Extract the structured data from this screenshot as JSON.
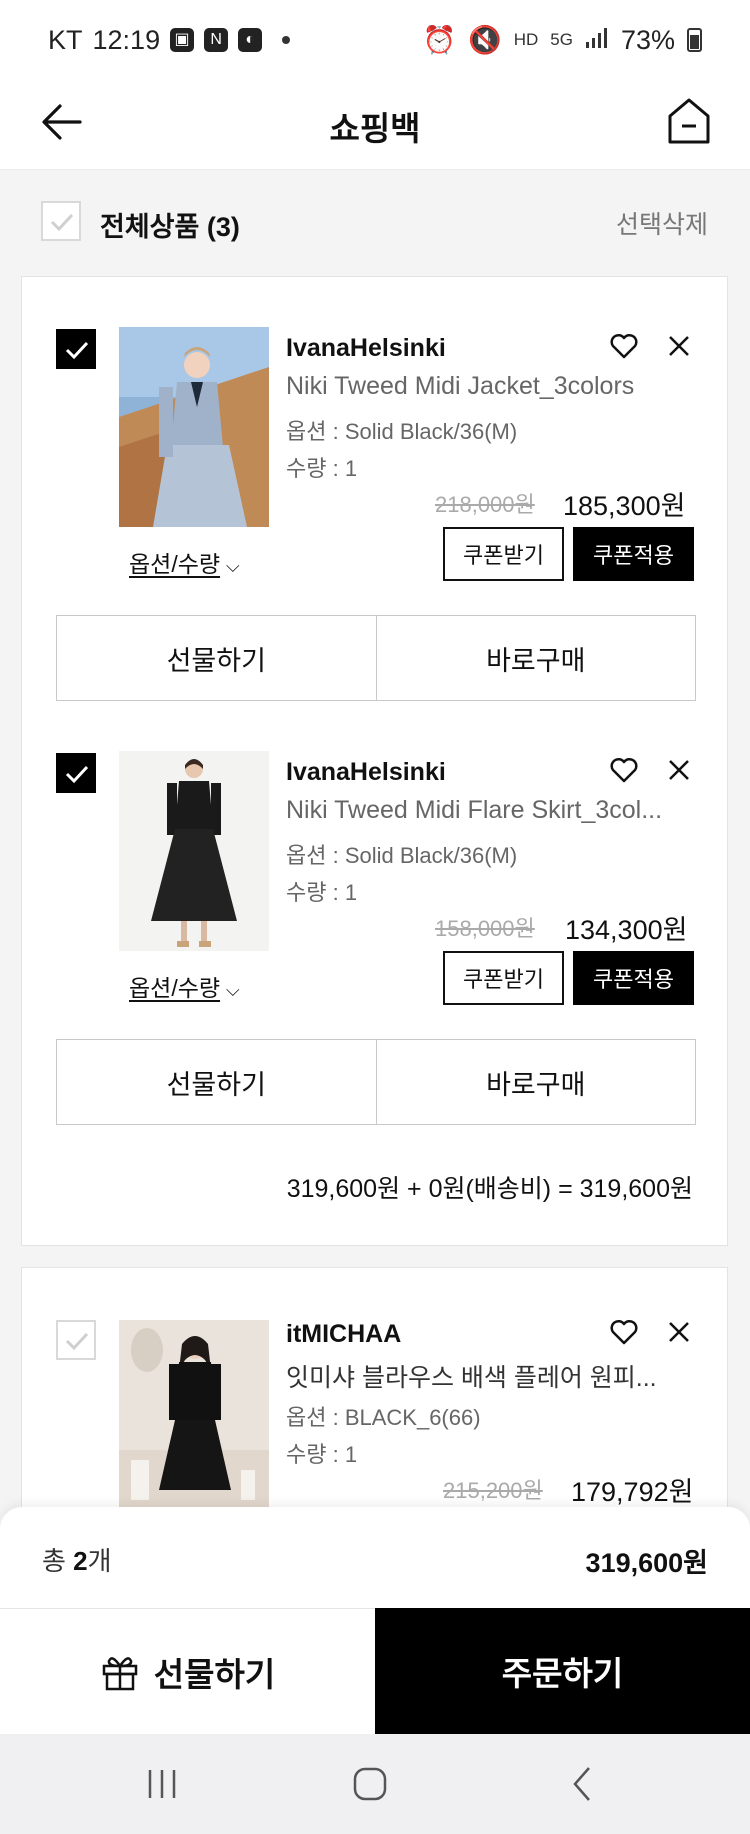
{
  "status_bar": {
    "carrier": "KT",
    "time": "12:19",
    "battery": "73%",
    "net": "5G"
  },
  "header": {
    "title": "쇼핑백"
  },
  "select_all": {
    "label": "전체상품 (3)",
    "delete_label": "선택삭제"
  },
  "items": [
    {
      "brand": "IvanaHelsinki",
      "name": "Niki Tweed Midi Jacket_3colors",
      "option": "옵션 : Solid Black/36(M)",
      "quantity": "수량 : 1",
      "original_price": "218,000원",
      "price": "185,300원",
      "coupon_receive": "쿠폰받기",
      "coupon_apply": "쿠폰적용",
      "option_qty_label": "옵션/수량",
      "gift_label": "선물하기",
      "buy_now_label": "바로구매",
      "checked": true
    },
    {
      "brand": "IvanaHelsinki",
      "name": "Niki Tweed Midi Flare Skirt_3col...",
      "option": "옵션 : Solid Black/36(M)",
      "quantity": "수량 : 1",
      "original_price": "158,000원",
      "price": "134,300원",
      "coupon_receive": "쿠폰받기",
      "coupon_apply": "쿠폰적용",
      "option_qty_label": "옵션/수량",
      "gift_label": "선물하기",
      "buy_now_label": "바로구매",
      "checked": true
    },
    {
      "brand": "itMICHAA",
      "name": "잇미샤 블라우스 배색 플레어 원피...",
      "option": "옵션 : BLACK_6(66)",
      "quantity": "수량 : 1",
      "original_price": "215,200원",
      "price": "179,792원",
      "checked": false
    }
  ],
  "group_summary": "319,600원 + 0원(배송비) = 319,600원",
  "total": {
    "count_prefix": "총 ",
    "count": "2",
    "count_suffix": "개",
    "amount": "319,600원"
  },
  "order_bar": {
    "gift_label": "선물하기",
    "order_label": "주문하기"
  }
}
